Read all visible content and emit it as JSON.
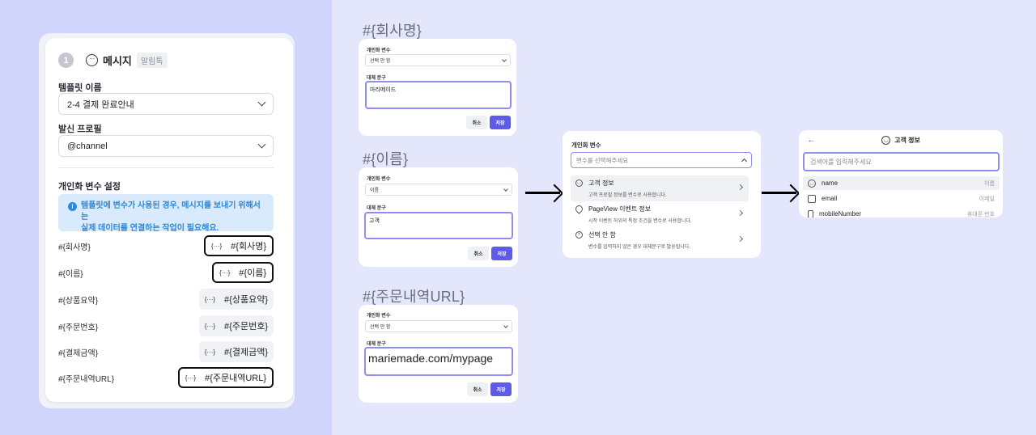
{
  "panel": {
    "step_number": "1",
    "step_title": "메시지",
    "step_badge": "알림톡",
    "template_label": "템플릿 이름",
    "template_value": "2-4 결제 완료안내",
    "profile_label": "발신 프로필",
    "profile_value": "@channel",
    "vars_heading": "개인화 변수 설정",
    "info_line1": "템플릿에 변수가 사용된 경우, 메시지를 보내기 위해서는",
    "info_line2": "실제 데이터를 연결하는 작업이 필요해요.",
    "chip_dots": "{···}",
    "variables": [
      {
        "name": "#{회사명}",
        "chip": "#{회사명}"
      },
      {
        "name": "#{이름}",
        "chip": "#{이름}"
      },
      {
        "name": "#{상품요약}",
        "chip": "#{상품요약}"
      },
      {
        "name": "#{주문번호}",
        "chip": "#{주문번호}"
      },
      {
        "name": "#{결제금액}",
        "chip": "#{결제금액}"
      },
      {
        "name": "#{주문내역URL}",
        "chip": "#{주문내역URL}"
      }
    ]
  },
  "popups": {
    "var_label": "개인화 변수",
    "alt_label": "대체 문구",
    "cancel": "취소",
    "save": "저장",
    "company": {
      "heading": "#{회사명}",
      "select": "선택 안 함",
      "text": "마리메이드"
    },
    "name": {
      "heading": "#{이름}",
      "select": "이름",
      "text": "고객"
    },
    "url": {
      "heading": "#{주문내역URL}",
      "select": "선택 안 함",
      "text": "mariemade.com/mypage"
    }
  },
  "dropdown": {
    "label": "개인화 변수",
    "placeholder": "변수를 선택해주세요",
    "items": [
      {
        "title": "고객 정보",
        "sub": "고객 프로필 정보를 변수로 사용합니다."
      },
      {
        "title": "PageView 이벤트 정보",
        "sub": "시작 이벤트 하위의 특정 조건을 변수로 사용합니다."
      },
      {
        "title": "선택 안 함",
        "sub": "변수를 입력하지 않은 경우 대체문구로 발송됩니다."
      }
    ]
  },
  "customer": {
    "back": "←",
    "title": "고객 정보",
    "search_placeholder": "검색어를 입력해주세요",
    "rows": [
      {
        "label": "name",
        "right": "이름"
      },
      {
        "label": "email",
        "right": "이메일"
      },
      {
        "label": "mobileNumber",
        "right": "휴대폰 번호"
      }
    ]
  }
}
